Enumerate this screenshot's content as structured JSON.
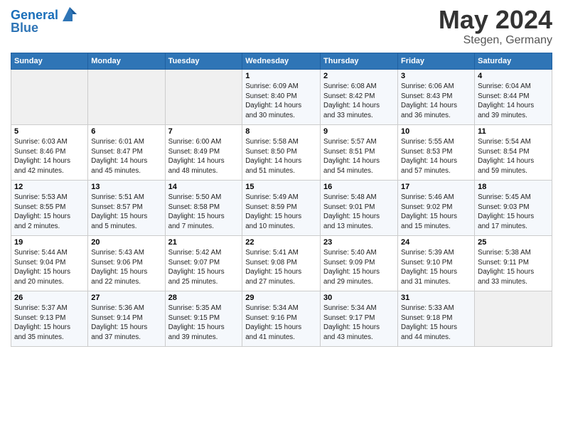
{
  "header": {
    "logo_line1": "General",
    "logo_line2": "Blue",
    "month": "May 2024",
    "location": "Stegen, Germany"
  },
  "weekdays": [
    "Sunday",
    "Monday",
    "Tuesday",
    "Wednesday",
    "Thursday",
    "Friday",
    "Saturday"
  ],
  "weeks": [
    [
      {
        "day": "",
        "info": ""
      },
      {
        "day": "",
        "info": ""
      },
      {
        "day": "",
        "info": ""
      },
      {
        "day": "1",
        "info": "Sunrise: 6:09 AM\nSunset: 8:40 PM\nDaylight: 14 hours\nand 30 minutes."
      },
      {
        "day": "2",
        "info": "Sunrise: 6:08 AM\nSunset: 8:42 PM\nDaylight: 14 hours\nand 33 minutes."
      },
      {
        "day": "3",
        "info": "Sunrise: 6:06 AM\nSunset: 8:43 PM\nDaylight: 14 hours\nand 36 minutes."
      },
      {
        "day": "4",
        "info": "Sunrise: 6:04 AM\nSunset: 8:44 PM\nDaylight: 14 hours\nand 39 minutes."
      }
    ],
    [
      {
        "day": "5",
        "info": "Sunrise: 6:03 AM\nSunset: 8:46 PM\nDaylight: 14 hours\nand 42 minutes."
      },
      {
        "day": "6",
        "info": "Sunrise: 6:01 AM\nSunset: 8:47 PM\nDaylight: 14 hours\nand 45 minutes."
      },
      {
        "day": "7",
        "info": "Sunrise: 6:00 AM\nSunset: 8:49 PM\nDaylight: 14 hours\nand 48 minutes."
      },
      {
        "day": "8",
        "info": "Sunrise: 5:58 AM\nSunset: 8:50 PM\nDaylight: 14 hours\nand 51 minutes."
      },
      {
        "day": "9",
        "info": "Sunrise: 5:57 AM\nSunset: 8:51 PM\nDaylight: 14 hours\nand 54 minutes."
      },
      {
        "day": "10",
        "info": "Sunrise: 5:55 AM\nSunset: 8:53 PM\nDaylight: 14 hours\nand 57 minutes."
      },
      {
        "day": "11",
        "info": "Sunrise: 5:54 AM\nSunset: 8:54 PM\nDaylight: 14 hours\nand 59 minutes."
      }
    ],
    [
      {
        "day": "12",
        "info": "Sunrise: 5:53 AM\nSunset: 8:55 PM\nDaylight: 15 hours\nand 2 minutes."
      },
      {
        "day": "13",
        "info": "Sunrise: 5:51 AM\nSunset: 8:57 PM\nDaylight: 15 hours\nand 5 minutes."
      },
      {
        "day": "14",
        "info": "Sunrise: 5:50 AM\nSunset: 8:58 PM\nDaylight: 15 hours\nand 7 minutes."
      },
      {
        "day": "15",
        "info": "Sunrise: 5:49 AM\nSunset: 8:59 PM\nDaylight: 15 hours\nand 10 minutes."
      },
      {
        "day": "16",
        "info": "Sunrise: 5:48 AM\nSunset: 9:01 PM\nDaylight: 15 hours\nand 13 minutes."
      },
      {
        "day": "17",
        "info": "Sunrise: 5:46 AM\nSunset: 9:02 PM\nDaylight: 15 hours\nand 15 minutes."
      },
      {
        "day": "18",
        "info": "Sunrise: 5:45 AM\nSunset: 9:03 PM\nDaylight: 15 hours\nand 17 minutes."
      }
    ],
    [
      {
        "day": "19",
        "info": "Sunrise: 5:44 AM\nSunset: 9:04 PM\nDaylight: 15 hours\nand 20 minutes."
      },
      {
        "day": "20",
        "info": "Sunrise: 5:43 AM\nSunset: 9:06 PM\nDaylight: 15 hours\nand 22 minutes."
      },
      {
        "day": "21",
        "info": "Sunrise: 5:42 AM\nSunset: 9:07 PM\nDaylight: 15 hours\nand 25 minutes."
      },
      {
        "day": "22",
        "info": "Sunrise: 5:41 AM\nSunset: 9:08 PM\nDaylight: 15 hours\nand 27 minutes."
      },
      {
        "day": "23",
        "info": "Sunrise: 5:40 AM\nSunset: 9:09 PM\nDaylight: 15 hours\nand 29 minutes."
      },
      {
        "day": "24",
        "info": "Sunrise: 5:39 AM\nSunset: 9:10 PM\nDaylight: 15 hours\nand 31 minutes."
      },
      {
        "day": "25",
        "info": "Sunrise: 5:38 AM\nSunset: 9:11 PM\nDaylight: 15 hours\nand 33 minutes."
      }
    ],
    [
      {
        "day": "26",
        "info": "Sunrise: 5:37 AM\nSunset: 9:13 PM\nDaylight: 15 hours\nand 35 minutes."
      },
      {
        "day": "27",
        "info": "Sunrise: 5:36 AM\nSunset: 9:14 PM\nDaylight: 15 hours\nand 37 minutes."
      },
      {
        "day": "28",
        "info": "Sunrise: 5:35 AM\nSunset: 9:15 PM\nDaylight: 15 hours\nand 39 minutes."
      },
      {
        "day": "29",
        "info": "Sunrise: 5:34 AM\nSunset: 9:16 PM\nDaylight: 15 hours\nand 41 minutes."
      },
      {
        "day": "30",
        "info": "Sunrise: 5:34 AM\nSunset: 9:17 PM\nDaylight: 15 hours\nand 43 minutes."
      },
      {
        "day": "31",
        "info": "Sunrise: 5:33 AM\nSunset: 9:18 PM\nDaylight: 15 hours\nand 44 minutes."
      },
      {
        "day": "",
        "info": ""
      }
    ]
  ]
}
